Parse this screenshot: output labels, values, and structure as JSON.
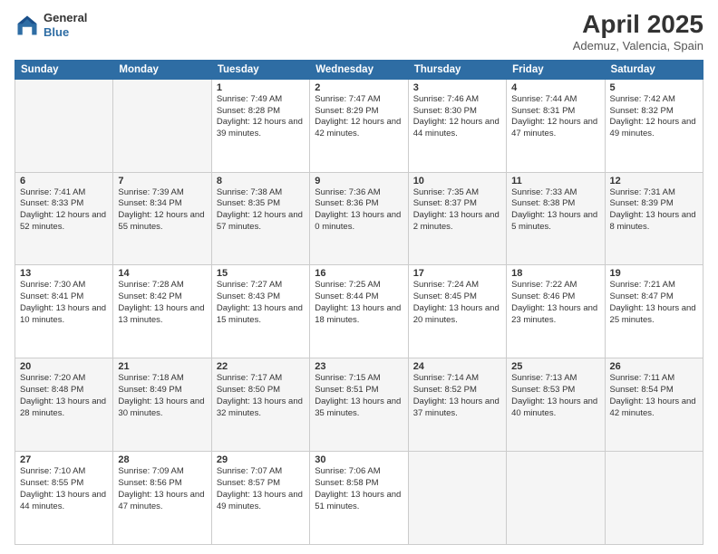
{
  "header": {
    "logo_line1": "General",
    "logo_line2": "Blue",
    "title": "April 2025",
    "subtitle": "Ademuz, Valencia, Spain"
  },
  "days_of_week": [
    "Sunday",
    "Monday",
    "Tuesday",
    "Wednesday",
    "Thursday",
    "Friday",
    "Saturday"
  ],
  "weeks": [
    [
      {
        "day": "",
        "info": ""
      },
      {
        "day": "",
        "info": ""
      },
      {
        "day": "1",
        "info": "Sunrise: 7:49 AM\nSunset: 8:28 PM\nDaylight: 12 hours and 39 minutes."
      },
      {
        "day": "2",
        "info": "Sunrise: 7:47 AM\nSunset: 8:29 PM\nDaylight: 12 hours and 42 minutes."
      },
      {
        "day": "3",
        "info": "Sunrise: 7:46 AM\nSunset: 8:30 PM\nDaylight: 12 hours and 44 minutes."
      },
      {
        "day": "4",
        "info": "Sunrise: 7:44 AM\nSunset: 8:31 PM\nDaylight: 12 hours and 47 minutes."
      },
      {
        "day": "5",
        "info": "Sunrise: 7:42 AM\nSunset: 8:32 PM\nDaylight: 12 hours and 49 minutes."
      }
    ],
    [
      {
        "day": "6",
        "info": "Sunrise: 7:41 AM\nSunset: 8:33 PM\nDaylight: 12 hours and 52 minutes."
      },
      {
        "day": "7",
        "info": "Sunrise: 7:39 AM\nSunset: 8:34 PM\nDaylight: 12 hours and 55 minutes."
      },
      {
        "day": "8",
        "info": "Sunrise: 7:38 AM\nSunset: 8:35 PM\nDaylight: 12 hours and 57 minutes."
      },
      {
        "day": "9",
        "info": "Sunrise: 7:36 AM\nSunset: 8:36 PM\nDaylight: 13 hours and 0 minutes."
      },
      {
        "day": "10",
        "info": "Sunrise: 7:35 AM\nSunset: 8:37 PM\nDaylight: 13 hours and 2 minutes."
      },
      {
        "day": "11",
        "info": "Sunrise: 7:33 AM\nSunset: 8:38 PM\nDaylight: 13 hours and 5 minutes."
      },
      {
        "day": "12",
        "info": "Sunrise: 7:31 AM\nSunset: 8:39 PM\nDaylight: 13 hours and 8 minutes."
      }
    ],
    [
      {
        "day": "13",
        "info": "Sunrise: 7:30 AM\nSunset: 8:41 PM\nDaylight: 13 hours and 10 minutes."
      },
      {
        "day": "14",
        "info": "Sunrise: 7:28 AM\nSunset: 8:42 PM\nDaylight: 13 hours and 13 minutes."
      },
      {
        "day": "15",
        "info": "Sunrise: 7:27 AM\nSunset: 8:43 PM\nDaylight: 13 hours and 15 minutes."
      },
      {
        "day": "16",
        "info": "Sunrise: 7:25 AM\nSunset: 8:44 PM\nDaylight: 13 hours and 18 minutes."
      },
      {
        "day": "17",
        "info": "Sunrise: 7:24 AM\nSunset: 8:45 PM\nDaylight: 13 hours and 20 minutes."
      },
      {
        "day": "18",
        "info": "Sunrise: 7:22 AM\nSunset: 8:46 PM\nDaylight: 13 hours and 23 minutes."
      },
      {
        "day": "19",
        "info": "Sunrise: 7:21 AM\nSunset: 8:47 PM\nDaylight: 13 hours and 25 minutes."
      }
    ],
    [
      {
        "day": "20",
        "info": "Sunrise: 7:20 AM\nSunset: 8:48 PM\nDaylight: 13 hours and 28 minutes."
      },
      {
        "day": "21",
        "info": "Sunrise: 7:18 AM\nSunset: 8:49 PM\nDaylight: 13 hours and 30 minutes."
      },
      {
        "day": "22",
        "info": "Sunrise: 7:17 AM\nSunset: 8:50 PM\nDaylight: 13 hours and 32 minutes."
      },
      {
        "day": "23",
        "info": "Sunrise: 7:15 AM\nSunset: 8:51 PM\nDaylight: 13 hours and 35 minutes."
      },
      {
        "day": "24",
        "info": "Sunrise: 7:14 AM\nSunset: 8:52 PM\nDaylight: 13 hours and 37 minutes."
      },
      {
        "day": "25",
        "info": "Sunrise: 7:13 AM\nSunset: 8:53 PM\nDaylight: 13 hours and 40 minutes."
      },
      {
        "day": "26",
        "info": "Sunrise: 7:11 AM\nSunset: 8:54 PM\nDaylight: 13 hours and 42 minutes."
      }
    ],
    [
      {
        "day": "27",
        "info": "Sunrise: 7:10 AM\nSunset: 8:55 PM\nDaylight: 13 hours and 44 minutes."
      },
      {
        "day": "28",
        "info": "Sunrise: 7:09 AM\nSunset: 8:56 PM\nDaylight: 13 hours and 47 minutes."
      },
      {
        "day": "29",
        "info": "Sunrise: 7:07 AM\nSunset: 8:57 PM\nDaylight: 13 hours and 49 minutes."
      },
      {
        "day": "30",
        "info": "Sunrise: 7:06 AM\nSunset: 8:58 PM\nDaylight: 13 hours and 51 minutes."
      },
      {
        "day": "",
        "info": ""
      },
      {
        "day": "",
        "info": ""
      },
      {
        "day": "",
        "info": ""
      }
    ]
  ]
}
